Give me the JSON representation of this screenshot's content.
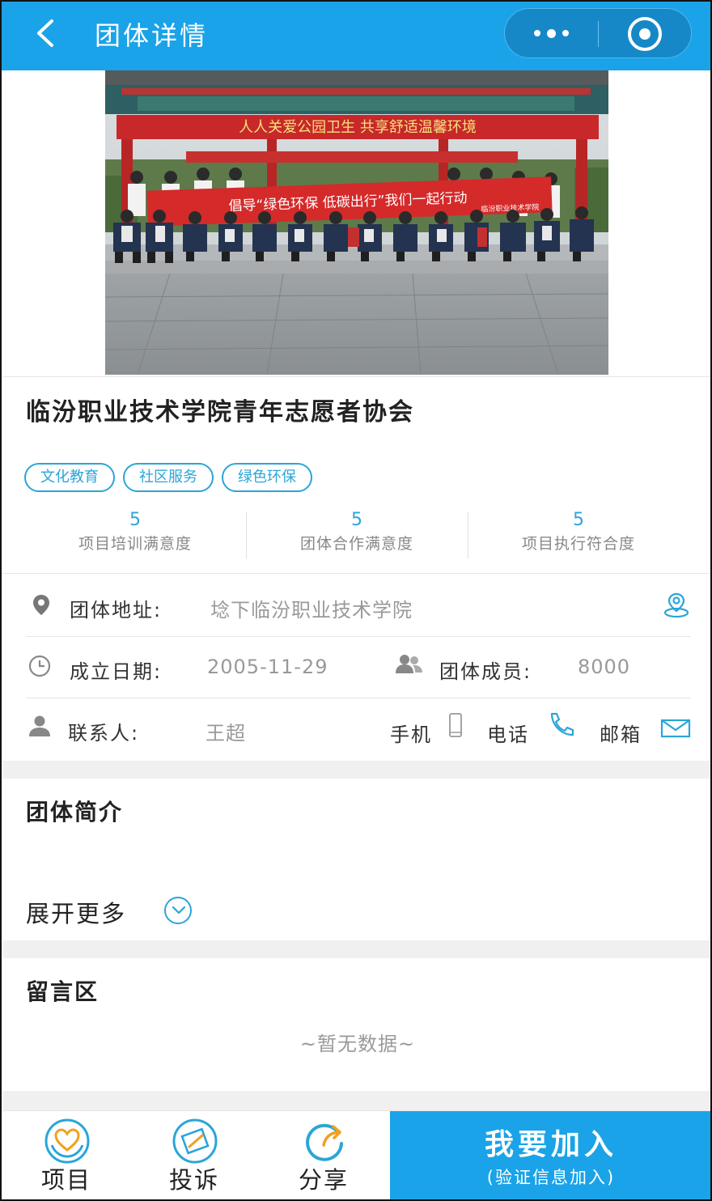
{
  "header": {
    "title": "团体详情",
    "back_icon": "chevron-left-icon",
    "more_icon": "more-dots-icon",
    "close_icon": "target-icon",
    "color": "#1aa3e8"
  },
  "org": {
    "name": "临汾职业技术学院青年志愿者协会",
    "tags": [
      "文化教育",
      "社区服务",
      "绿色环保"
    ],
    "photo": {
      "banner_top": "人人关爱公园卫生  共享舒适温馨环境",
      "banner_front": "倡导“绿色环保  低碳出行”我们一起行动",
      "banner_front_sub": "临汾职业技术学院"
    }
  },
  "stats": [
    {
      "value": "5",
      "label": "项目培训满意度"
    },
    {
      "value": "5",
      "label": "团体合作满意度"
    },
    {
      "value": "5",
      "label": "项目执行符合度"
    }
  ],
  "info": {
    "address_label": "团体地址:",
    "address_value": "埝下临汾职业技术学院",
    "founded_label": "成立日期:",
    "founded_value": "2005-11-29",
    "members_label": "团体成员:",
    "members_value": "8000",
    "contact_label": "联系人:",
    "contact_value": "王超",
    "mobile_label": "手机",
    "phone_label": "电话",
    "email_label": "邮箱"
  },
  "intro": {
    "title": "团体简介",
    "expand_label": "展开更多"
  },
  "comments": {
    "title": "留言区",
    "empty_text": "~暂无数据~"
  },
  "bottom": {
    "projects_label": "项目",
    "complaint_label": "投诉",
    "share_label": "分享",
    "join_label": "我要加入",
    "join_sub": "(验证信息加入)"
  },
  "colors": {
    "accent": "#2ba5d8",
    "primary": "#1aa3e8",
    "share_arrow": "#f0a020"
  }
}
